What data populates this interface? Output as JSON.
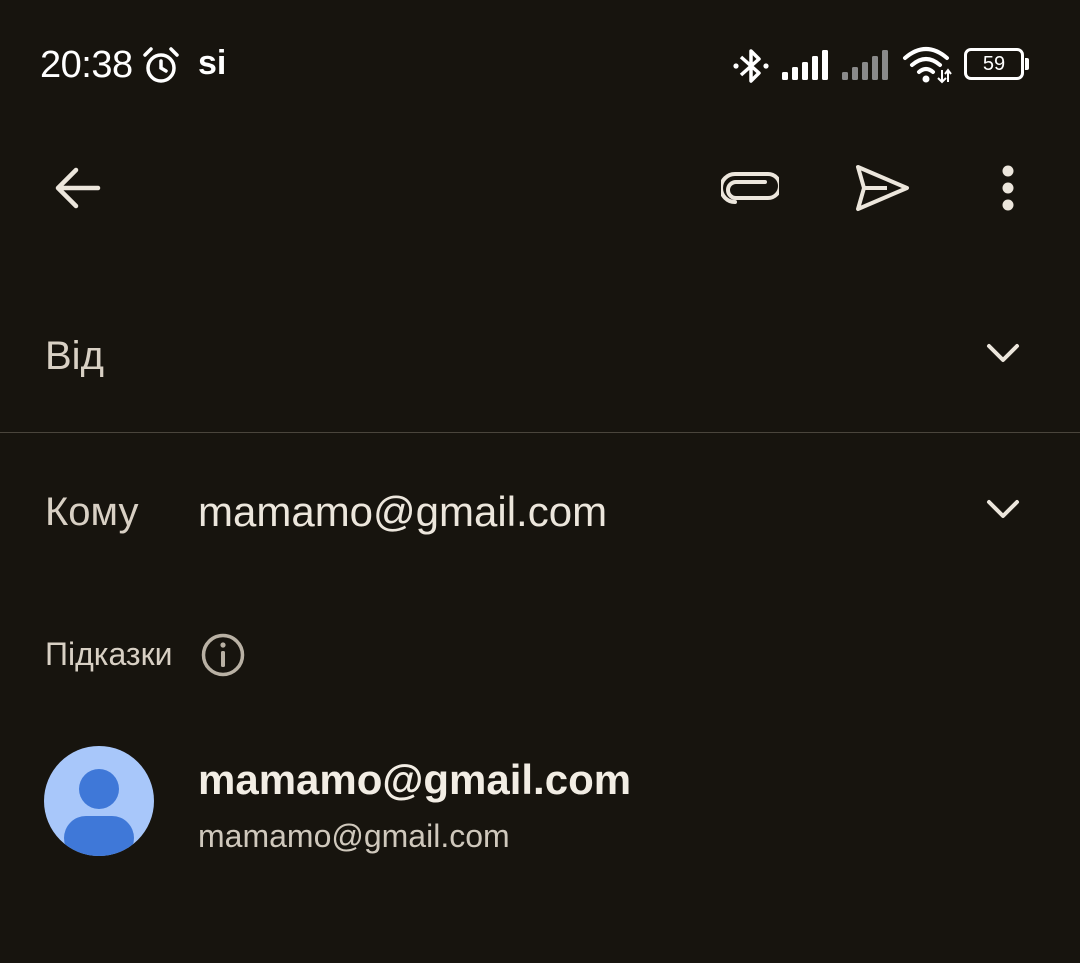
{
  "status_bar": {
    "time": "20:38",
    "carrier_glyph": "si",
    "battery_level": "59",
    "icons": [
      "alarm-icon",
      "bluetooth-icon",
      "signal-sim1-icon",
      "signal-sim2-icon",
      "wifi-icon",
      "battery-icon"
    ]
  },
  "toolbar": {
    "icons": [
      "back-arrow-icon",
      "paperclip-icon",
      "send-icon",
      "more-vert-icon"
    ]
  },
  "compose": {
    "from_label": "Від",
    "to_label": "Кому",
    "to_value": "mamamo@gmail.com"
  },
  "suggestions": {
    "header": "Підказки",
    "items": [
      {
        "name": "mamamo@gmail.com",
        "email": "mamamo@gmail.com"
      }
    ]
  },
  "colors": {
    "background": "#17140e",
    "text_primary": "#ece6dc",
    "text_secondary": "#d8d0c4",
    "avatar_bg": "#a8c7fa",
    "avatar_fg": "#3f78d8",
    "divider": "#4a453c"
  }
}
